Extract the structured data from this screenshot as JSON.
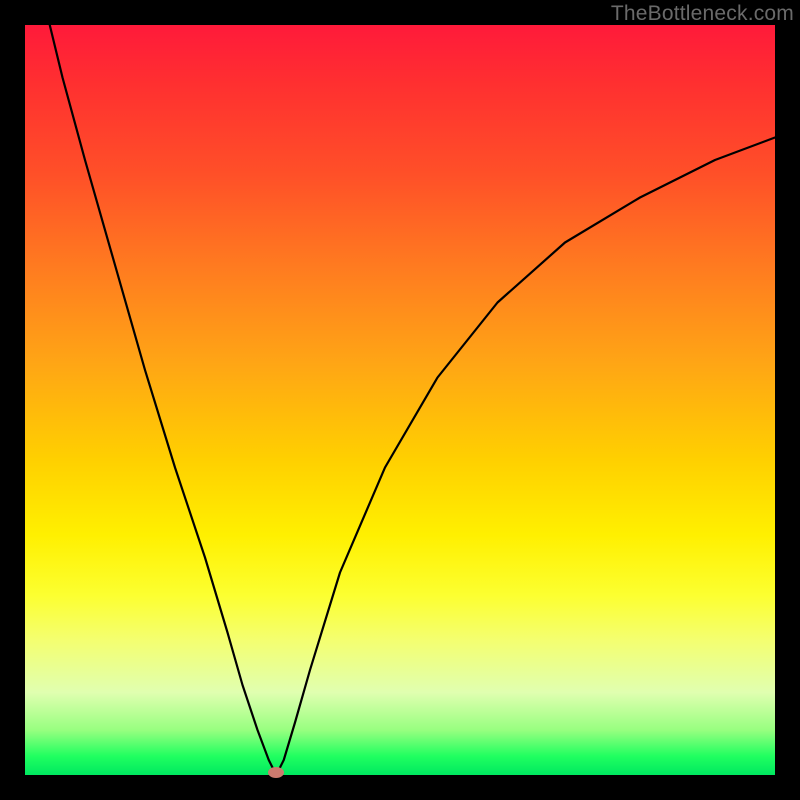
{
  "watermark": "TheBottleneck.com",
  "chart_data": {
    "type": "line",
    "title": "",
    "xlabel": "",
    "ylabel": "",
    "x_range": [
      0,
      100
    ],
    "y_range_percent": [
      0,
      100
    ],
    "curve_points": [
      {
        "x": 3.3,
        "y": 100
      },
      {
        "x": 5,
        "y": 93
      },
      {
        "x": 8,
        "y": 82
      },
      {
        "x": 12,
        "y": 68
      },
      {
        "x": 16,
        "y": 54
      },
      {
        "x": 20,
        "y": 41
      },
      {
        "x": 24,
        "y": 29
      },
      {
        "x": 27,
        "y": 19
      },
      {
        "x": 29,
        "y": 12
      },
      {
        "x": 31,
        "y": 6
      },
      {
        "x": 32.5,
        "y": 2
      },
      {
        "x": 33.5,
        "y": 0
      },
      {
        "x": 34.5,
        "y": 2
      },
      {
        "x": 36,
        "y": 7
      },
      {
        "x": 38,
        "y": 14
      },
      {
        "x": 42,
        "y": 27
      },
      {
        "x": 48,
        "y": 41
      },
      {
        "x": 55,
        "y": 53
      },
      {
        "x": 63,
        "y": 63
      },
      {
        "x": 72,
        "y": 71
      },
      {
        "x": 82,
        "y": 77
      },
      {
        "x": 92,
        "y": 82
      },
      {
        "x": 100,
        "y": 85
      }
    ],
    "marker": {
      "x": 33.5,
      "y": 0,
      "color": "#cc7a6e"
    },
    "background_gradient": {
      "top": "#ff1a3a",
      "mid_upper": "#ffa515",
      "mid": "#fff000",
      "mid_lower": "#f4ff70",
      "bottom": "#00e860"
    }
  }
}
